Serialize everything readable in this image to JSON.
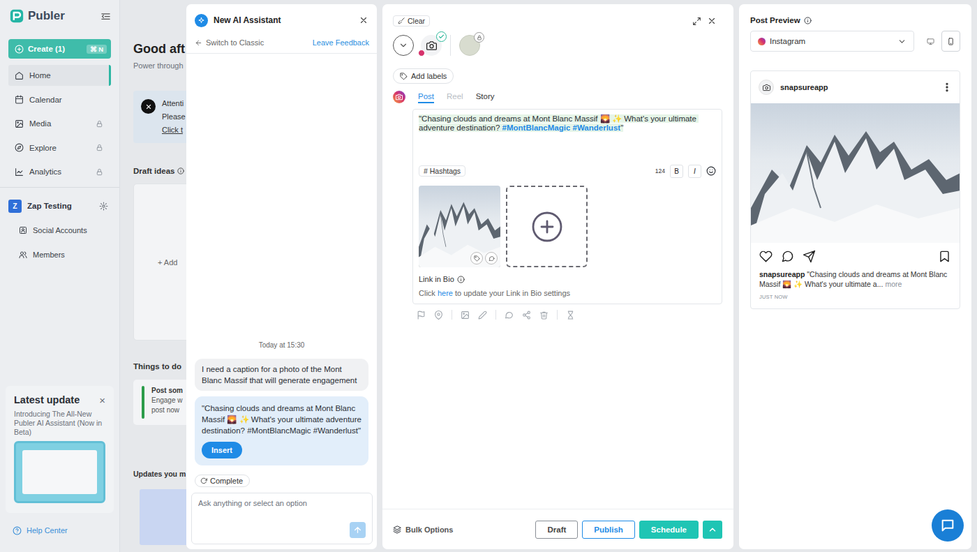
{
  "sidebar": {
    "logo": "Publer",
    "create": {
      "label": "Create (1)",
      "shortcut": "⌘ N"
    },
    "items": [
      {
        "label": "Home",
        "selected": true,
        "locked": false
      },
      {
        "label": "Calendar",
        "selected": false,
        "locked": false
      },
      {
        "label": "Media",
        "selected": false,
        "locked": true
      },
      {
        "label": "Explore",
        "selected": false,
        "locked": true
      },
      {
        "label": "Analytics",
        "selected": false,
        "locked": true
      }
    ],
    "workspace": {
      "initial": "Z",
      "name": "Zap Testing",
      "items": [
        {
          "label": "Social Accounts"
        },
        {
          "label": "Members"
        }
      ]
    },
    "latest_update": {
      "title": "Latest update",
      "close": "×",
      "text": "Introducing The All-New Publer AI Assistant (Now in Beta)"
    },
    "help": "Help Center"
  },
  "dashboard": {
    "greeting": "Good aft",
    "subtitle": "Power through",
    "banner": [
      "Attenti",
      "Please",
      "Click t"
    ],
    "draft_ideas": "Draft ideas",
    "add_draft": "+ Add",
    "things_to_do": "Things to do",
    "todo": [
      "Post som",
      "Engage w",
      "post now"
    ],
    "updates": "Updates you m"
  },
  "assistant": {
    "title": "New AI Assistant",
    "switch": "Switch to Classic",
    "feedback": "Leave Feedback",
    "timestamp": "Today at 15:30",
    "messages": [
      {
        "kind": "user",
        "text": "I need a caption for a photo of the Mont Blanc Massif that will generate engagement"
      },
      {
        "kind": "assistant",
        "text": "\"Chasing clouds and dreams at Mont Blanc Massif 🌄 ✨ What's your ultimate adventure destination? #MontBlancMagic #Wanderlust\"",
        "action": "Insert"
      }
    ],
    "complete": "Complete",
    "input_placeholder": "Ask anything or select an option"
  },
  "composer": {
    "clear": "Clear",
    "accounts": [
      {
        "selected": true,
        "locked": false
      },
      {
        "selected": false,
        "locked": true
      }
    ],
    "add_labels": "Add labels",
    "tabs": [
      {
        "label": "Post",
        "selected": true,
        "disabled": false
      },
      {
        "label": "Reel",
        "selected": false,
        "disabled": true
      },
      {
        "label": "Story",
        "selected": false,
        "disabled": false
      }
    ],
    "caption": [
      {
        "kind": "text",
        "text": "\"Chasing clouds and dreams at Mont Blanc Massif 🌄 ✨ What's your ultimate adventure destination? "
      },
      {
        "kind": "hashtag",
        "text": "#MontBlancMagic"
      },
      {
        "kind": "text",
        "text": " "
      },
      {
        "kind": "hashtag",
        "text": "#Wanderlust"
      },
      {
        "kind": "text",
        "text": "\""
      }
    ],
    "hashtags_button": "# Hashtags",
    "char_count": "124",
    "bold": "B",
    "italic": "I",
    "link_in_bio": {
      "title": "Link in Bio",
      "before": "Click ",
      "link": "here",
      "after": " to update your Link in Bio settings"
    },
    "bulk_options": "Bulk Options",
    "buttons": {
      "draft": "Draft",
      "publish": "Publish",
      "schedule": "Schedule"
    }
  },
  "preview": {
    "title": "Post Preview",
    "network": "Instagram",
    "devices": [
      {
        "kind": "desktop",
        "selected": false
      },
      {
        "kind": "mobile",
        "selected": true
      }
    ],
    "username": "snapsureapp",
    "caption_user": "snapsureapp",
    "caption": "\"Chasing clouds and dreams at Mont Blanc Massif 🌄 ✨ What's your ultimate a...",
    "more": "more",
    "time": "JUST NOW"
  }
}
